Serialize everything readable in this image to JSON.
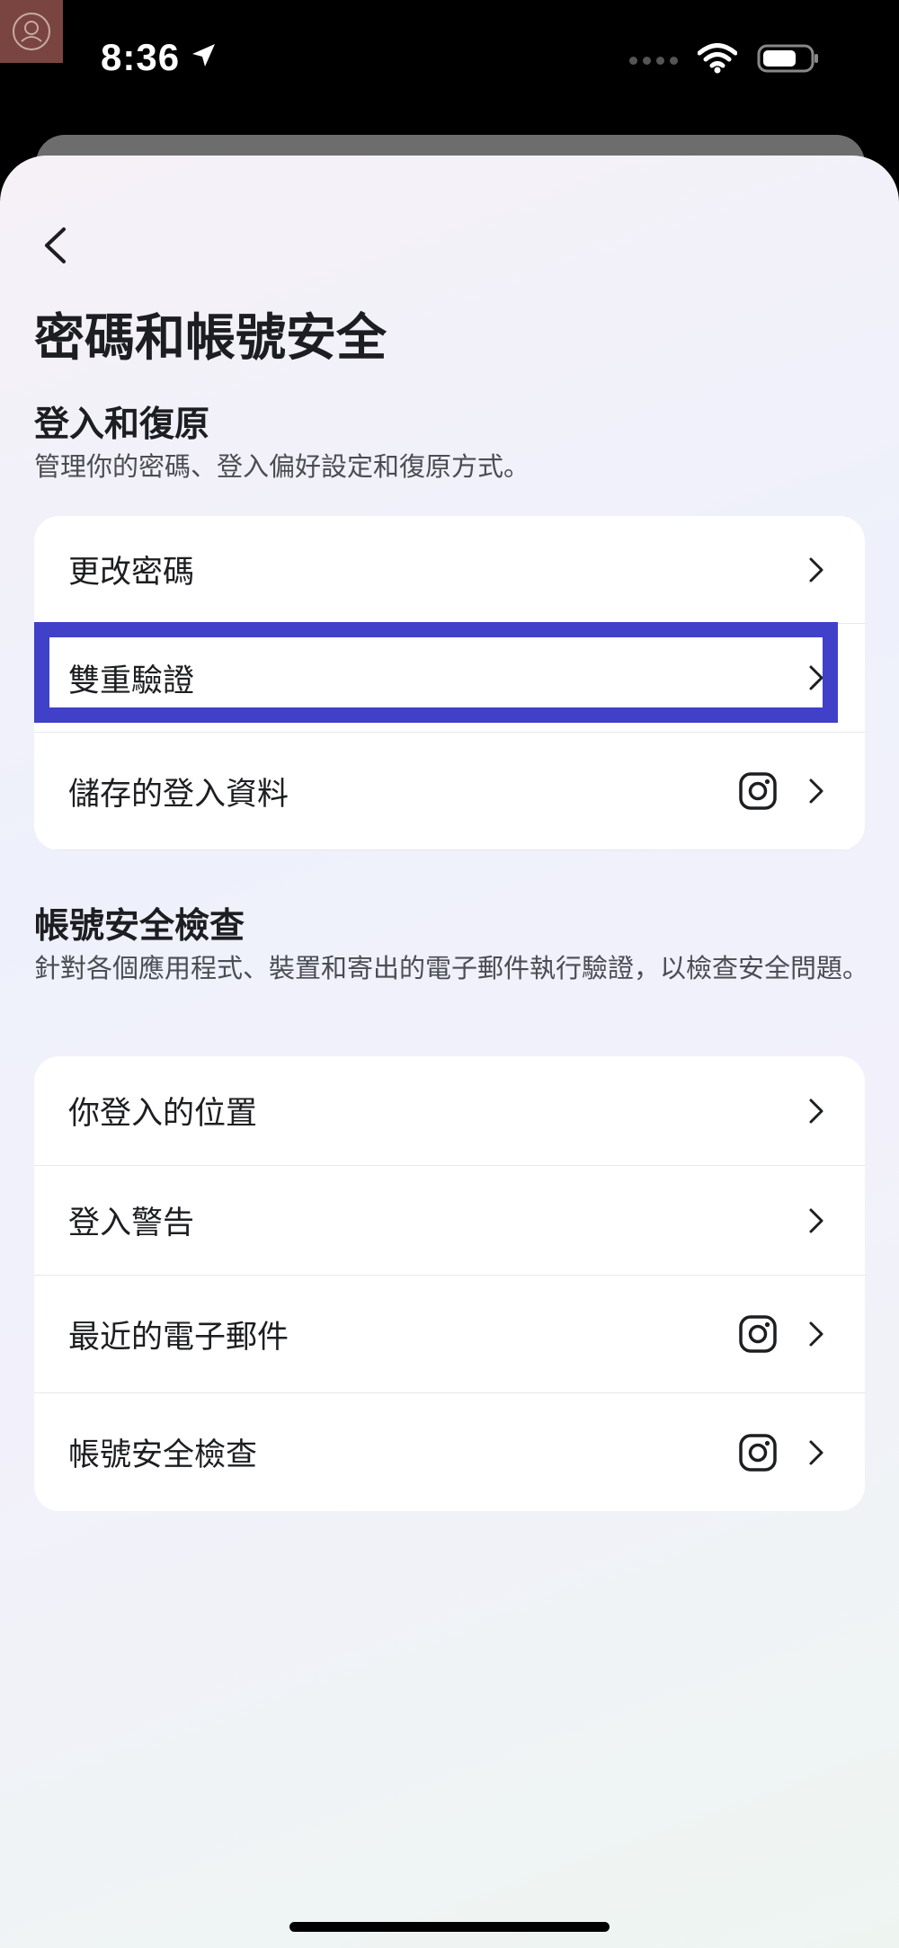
{
  "status_bar": {
    "time": "8:36"
  },
  "header": {
    "title": "密碼和帳號安全"
  },
  "login_section": {
    "title": "登入和復原",
    "description": "管理你的密碼、登入偏好設定和復原方式。",
    "items": [
      {
        "label": "更改密碼",
        "has_instagram_icon": false
      },
      {
        "label": "雙重驗證",
        "has_instagram_icon": false,
        "highlighted": true
      },
      {
        "label": "儲存的登入資料",
        "has_instagram_icon": true
      }
    ]
  },
  "security_section": {
    "title": "帳號安全檢查",
    "description": "針對各個應用程式、裝置和寄出的電子郵件執行驗證，以檢查安全問題。",
    "items": [
      {
        "label": "你登入的位置",
        "has_instagram_icon": false
      },
      {
        "label": "登入警告",
        "has_instagram_icon": false
      },
      {
        "label": "最近的電子郵件",
        "has_instagram_icon": true
      },
      {
        "label": "帳號安全檢查",
        "has_instagram_icon": true
      }
    ]
  },
  "colors": {
    "highlight": "#4040c8",
    "text_primary": "#1c1e21",
    "text_secondary": "#4a4d52"
  }
}
